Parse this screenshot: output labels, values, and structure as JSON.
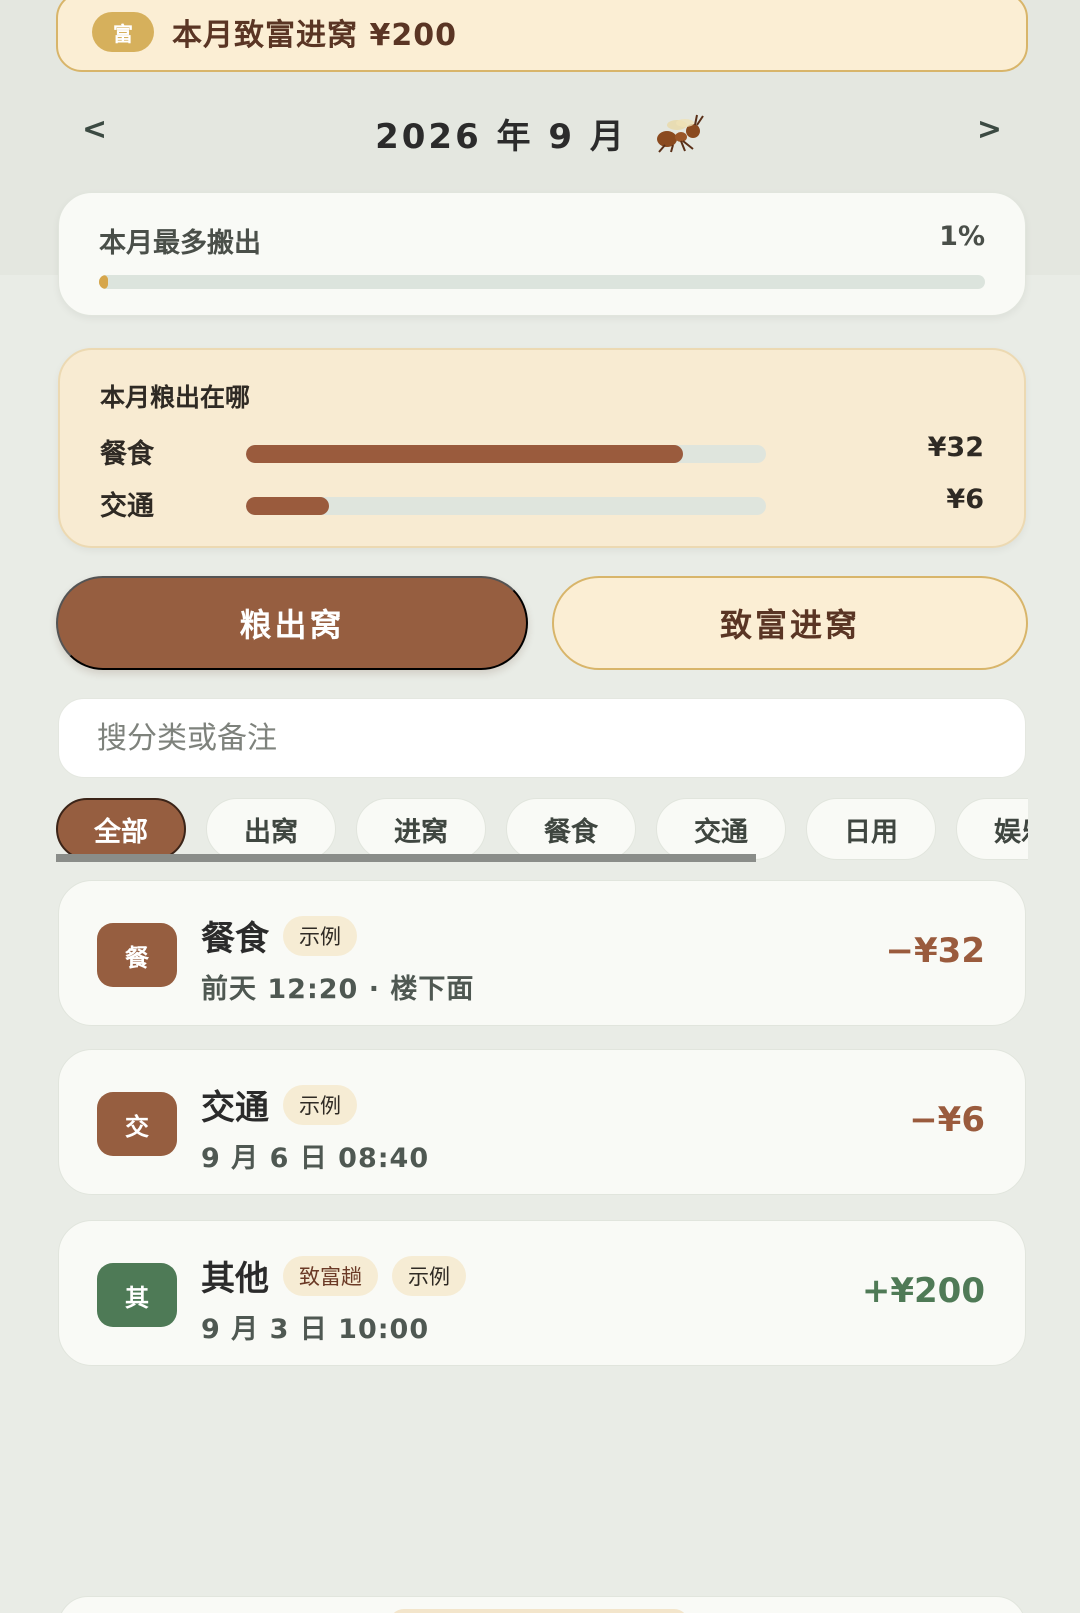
{
  "banner": {
    "badge": "富",
    "text": "本月致富进窝 ¥200"
  },
  "month_nav": {
    "prev": "<",
    "next": ">",
    "title": "2026 年 9 月",
    "mascot_icon": "ant-icon"
  },
  "progress_card": {
    "label": "本月最多搬出",
    "percent_text": "1%",
    "percent_value": 1
  },
  "distribution": {
    "title": "本月粮出在哪",
    "rows": [
      {
        "name": "餐食",
        "amount": "¥32",
        "fraction": 0.84
      },
      {
        "name": "交通",
        "amount": "¥6",
        "fraction": 0.16
      }
    ]
  },
  "actions": {
    "out_label": "粮出窝",
    "in_label": "致富进窝"
  },
  "search": {
    "placeholder": "搜分类或备注",
    "value": ""
  },
  "filters": {
    "active_index": 0,
    "chips": [
      "全部",
      "出窝",
      "进窝",
      "餐食",
      "交通",
      "日用",
      "娱乐"
    ]
  },
  "transactions": [
    {
      "icon_text": "餐",
      "icon_color": "#965e40",
      "name": "餐食",
      "tags": [
        "示例"
      ],
      "sub": "前天 12:20 · 楼下面",
      "amount": "−¥32",
      "kind": "neg"
    },
    {
      "icon_text": "交",
      "icon_color": "#965e40",
      "name": "交通",
      "tags": [
        "示例"
      ],
      "sub": "9 月 6 日 08:40",
      "amount": "−¥6",
      "kind": "neg"
    },
    {
      "icon_text": "其",
      "icon_color": "#4e7a56",
      "name": "其他",
      "tags": [
        "致富趟",
        "示例"
      ],
      "sub": "9 月 3 日 10:00",
      "amount": "+¥200",
      "kind": "pos"
    }
  ],
  "colors": {
    "accent_brown": "#965e40",
    "gold": "#d6b05c",
    "green": "#4e7a56",
    "background": "#e9ece6"
  }
}
